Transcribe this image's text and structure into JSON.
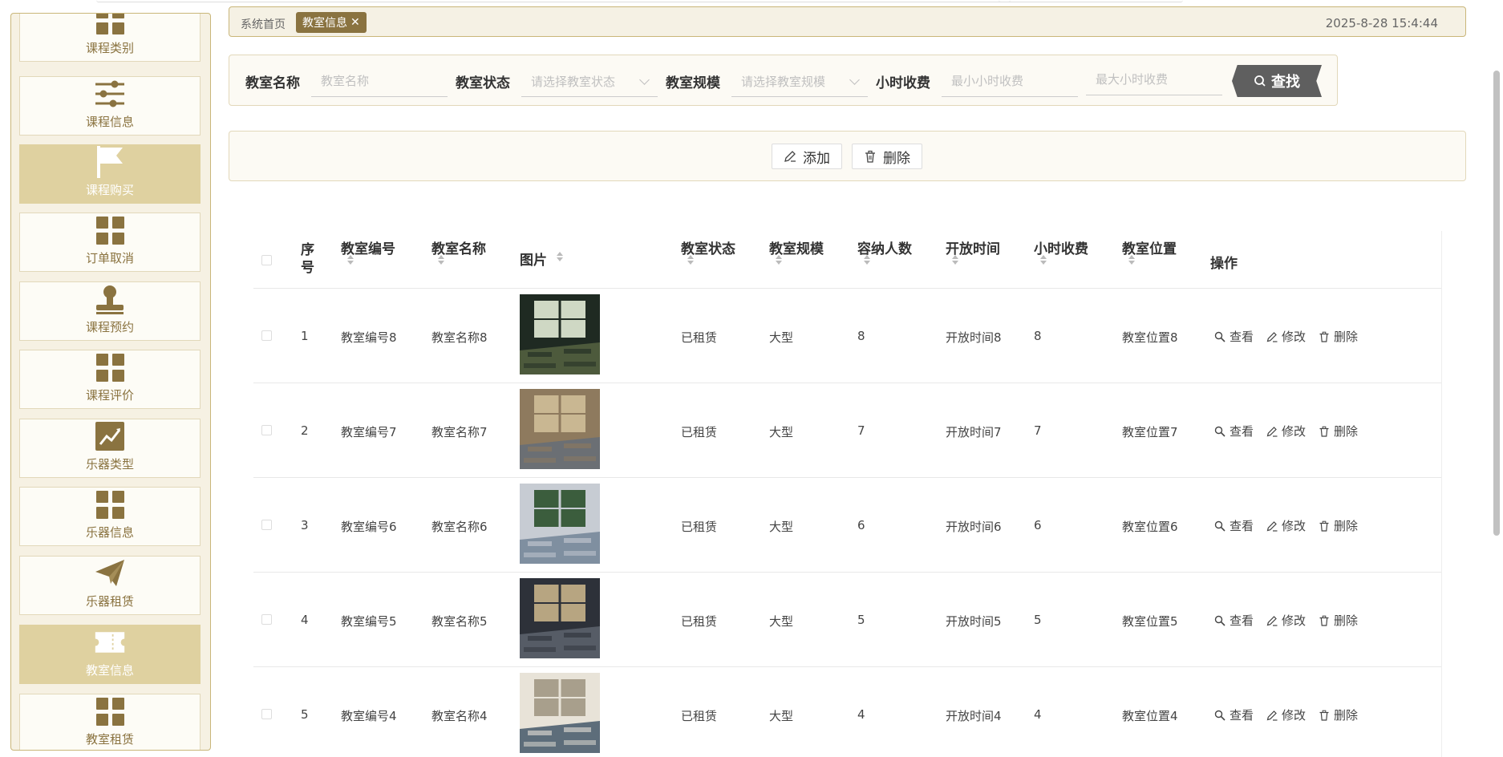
{
  "sidebar": {
    "items": [
      {
        "label": "课程类别",
        "icon": "grid-icon",
        "active": false
      },
      {
        "label": "课程信息",
        "icon": "sliders-icon",
        "active": false
      },
      {
        "label": "课程购买",
        "icon": "flag-icon",
        "active": true
      },
      {
        "label": "订单取消",
        "icon": "grid-icon",
        "active": false
      },
      {
        "label": "课程预约",
        "icon": "stamp-icon",
        "active": false
      },
      {
        "label": "课程评价",
        "icon": "grid-icon",
        "active": false
      },
      {
        "label": "乐器类型",
        "icon": "chart-icon",
        "active": false
      },
      {
        "label": "乐器信息",
        "icon": "grid-icon",
        "active": false
      },
      {
        "label": "乐器租赁",
        "icon": "paper-plane-icon",
        "active": false
      },
      {
        "label": "教室信息",
        "icon": "ticket-icon",
        "active": true
      },
      {
        "label": "教室租赁",
        "icon": "grid-icon",
        "active": false
      }
    ]
  },
  "tabs": {
    "home": "系统首页",
    "active": "教室信息",
    "close": "✕"
  },
  "clock": "2025-8-28 15:4:44",
  "search": {
    "name_label": "教室名称",
    "name_placeholder": "教室名称",
    "status_label": "教室状态",
    "status_placeholder": "请选择教室状态",
    "scale_label": "教室规模",
    "scale_placeholder": "请选择教室规模",
    "fee_label": "小时收费",
    "fee_min_placeholder": "最小小时收费",
    "fee_max_placeholder": "最大小时收费",
    "button": "查找"
  },
  "actions": {
    "add": "添加",
    "delete": "删除"
  },
  "table": {
    "headers": {
      "index": "序号",
      "code": "教室编号",
      "name": "教室名称",
      "image": "图片",
      "status": "教室状态",
      "scale": "教室规模",
      "capacity": "容纳人数",
      "open_time": "开放时间",
      "fee": "小时收费",
      "location": "教室位置",
      "ops": "操作"
    },
    "op_labels": {
      "view": "查看",
      "edit": "修改",
      "delete": "删除"
    },
    "rows": [
      {
        "index": "1",
        "code": "教室编号8",
        "name": "教室名称8",
        "status": "已租赁",
        "scale": "大型",
        "capacity": "8",
        "open_time": "开放时间8",
        "fee": "8",
        "location": "教室位置8"
      },
      {
        "index": "2",
        "code": "教室编号7",
        "name": "教室名称7",
        "status": "已租赁",
        "scale": "大型",
        "capacity": "7",
        "open_time": "开放时间7",
        "fee": "7",
        "location": "教室位置7"
      },
      {
        "index": "3",
        "code": "教室编号6",
        "name": "教室名称6",
        "status": "已租赁",
        "scale": "大型",
        "capacity": "6",
        "open_time": "开放时间6",
        "fee": "6",
        "location": "教室位置6"
      },
      {
        "index": "4",
        "code": "教室编号5",
        "name": "教室名称5",
        "status": "已租赁",
        "scale": "大型",
        "capacity": "5",
        "open_time": "开放时间5",
        "fee": "5",
        "location": "教室位置5"
      },
      {
        "index": "5",
        "code": "教室编号4",
        "name": "教室名称4",
        "status": "已租赁",
        "scale": "大型",
        "capacity": "4",
        "open_time": "开放时间4",
        "fee": "4",
        "location": "教室位置4"
      }
    ]
  },
  "colors": {
    "accent": "#8a7340",
    "active_bg": "#dfd1a0",
    "panel_border": "#c9b679"
  }
}
